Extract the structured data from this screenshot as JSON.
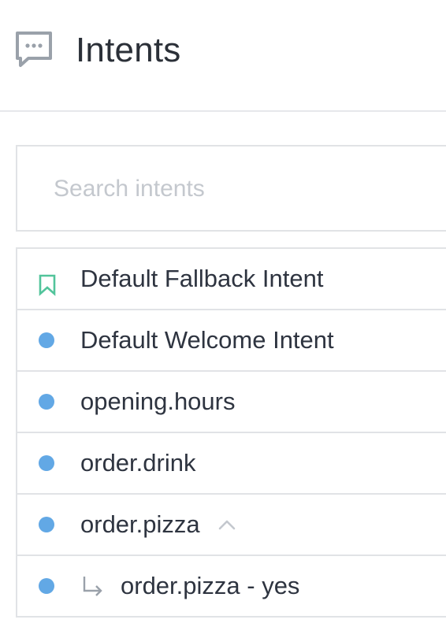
{
  "header": {
    "title": "Intents",
    "icon": "chat-bubble-icon"
  },
  "search": {
    "placeholder": "Search intents",
    "value": ""
  },
  "intents": [
    {
      "label": "Default Fallback Intent",
      "marker": "bookmark-icon",
      "marker_color": "#52c49b"
    },
    {
      "label": "Default Welcome Intent",
      "marker": "dot",
      "marker_color": "#62a8e5"
    },
    {
      "label": "opening.hours",
      "marker": "dot",
      "marker_color": "#62a8e5"
    },
    {
      "label": "order.drink",
      "marker": "dot",
      "marker_color": "#62a8e5"
    },
    {
      "label": "order.pizza",
      "marker": "dot",
      "marker_color": "#62a8e5",
      "expanded": true,
      "toggle_icon": "chevron-up-icon"
    },
    {
      "label": "order.pizza - yes",
      "marker": "dot",
      "marker_color": "#62a8e5",
      "child_of": "order.pizza",
      "child_icon": "subdirectory-arrow-icon"
    }
  ],
  "colors": {
    "accent_dot": "#62a8e5",
    "bookmark": "#52c49b",
    "border": "#e1e3e6",
    "text": "#2e3440",
    "placeholder": "#c4c8ce",
    "icon_gray": "#9aa1aa"
  }
}
